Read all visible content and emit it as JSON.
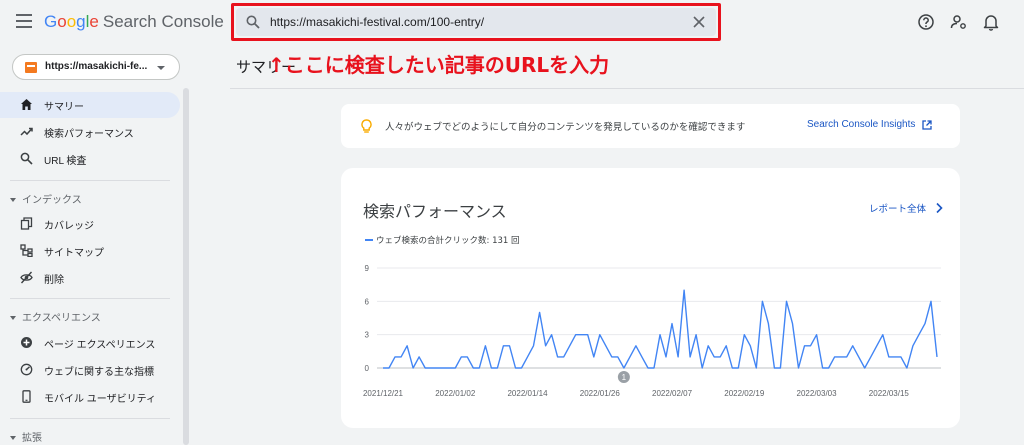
{
  "header": {
    "logo_letters": [
      "G",
      "o",
      "o",
      "g",
      "l",
      "e"
    ],
    "product_name": "Search Console",
    "search_value": "https://masakichi-festival.com/100-entry/",
    "icons": [
      "menu-icon",
      "search-icon",
      "close-icon",
      "help-icon",
      "account-settings-icon",
      "notifications-icon"
    ]
  },
  "annotation": {
    "text": "↑ここに検査したい記事のURLを入力",
    "color": "#e8121d"
  },
  "sidebar": {
    "property_label": "https://masakichi-fe...",
    "items": [
      {
        "label": "サマリー",
        "icon": "home-icon",
        "active": true
      },
      {
        "label": "検索パフォーマンス",
        "icon": "trending-icon",
        "active": false
      },
      {
        "label": "URL 検査",
        "icon": "search-icon",
        "active": false
      }
    ],
    "sections": [
      {
        "title": "インデックス",
        "items": [
          {
            "label": "カバレッジ",
            "icon": "coverage-icon"
          },
          {
            "label": "サイトマップ",
            "icon": "sitemap-icon"
          },
          {
            "label": "削除",
            "icon": "removals-icon"
          }
        ]
      },
      {
        "title": "エクスペリエンス",
        "items": [
          {
            "label": "ページ エクスペリエンス",
            "icon": "page-experience-icon"
          },
          {
            "label": "ウェブに関する主な指標",
            "icon": "web-vitals-icon"
          },
          {
            "label": "モバイル ユーザビリティ",
            "icon": "mobile-icon"
          }
        ]
      },
      {
        "title": "拡張",
        "items": []
      }
    ]
  },
  "main": {
    "page_title": "サマリー",
    "insight_text": "人々がウェブでどのようにして自分のコンテンツを発見しているのかを確認できます",
    "insight_link": "Search Console Insights",
    "card_title": "検索パフォーマンス",
    "full_report_label": "レポート全体",
    "legend_label": "ウェブ検索の合計クリック数: 131 回",
    "event_marker_label": "1"
  },
  "colors": {
    "accent_blue": "#4285f4",
    "link_blue": "#1a56c4",
    "annotation_red": "#e8121d",
    "active_nav": "#e2eaf8"
  },
  "chart_data": {
    "type": "line",
    "title": "検索パフォーマンス",
    "series": [
      {
        "name": "ウェブ検索の合計クリック数: 131 回",
        "values": [
          0,
          0,
          1,
          1,
          2,
          0,
          1,
          0,
          0,
          0,
          0,
          0,
          0,
          1,
          1,
          0,
          0,
          2,
          0,
          0,
          2,
          2,
          0,
          0,
          1,
          2,
          5,
          2,
          3,
          1,
          1,
          2,
          3,
          3,
          3,
          1,
          3,
          2,
          1,
          1,
          0,
          1,
          2,
          1,
          0,
          0,
          3,
          1,
          4,
          1,
          7,
          1,
          3,
          0,
          2,
          1,
          1,
          2,
          0,
          0,
          3,
          2,
          0,
          6,
          4,
          0,
          0,
          6,
          4,
          0,
          2,
          2,
          3,
          0,
          0,
          1,
          1,
          1,
          2,
          1,
          0,
          1,
          2,
          3,
          1,
          1,
          1,
          0,
          2,
          3,
          4,
          6,
          1
        ]
      }
    ],
    "x_tick_labels": [
      "2021/12/21",
      "2022/01/02",
      "2022/01/14",
      "2022/01/26",
      "2022/02/07",
      "2022/02/19",
      "2022/03/03",
      "2022/03/15"
    ],
    "x_tick_index": [
      0,
      12,
      24,
      36,
      48,
      60,
      72,
      84
    ],
    "y_ticks": [
      0,
      3,
      6,
      9
    ],
    "ylim": [
      0,
      9
    ],
    "event_marker_index": 40,
    "grid": true,
    "legend": "top-left"
  }
}
